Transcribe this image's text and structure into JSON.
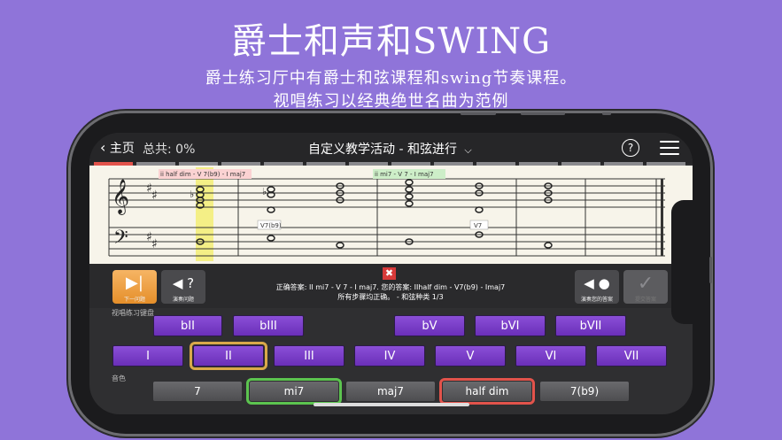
{
  "promo": {
    "headline": "爵士和声和SWING",
    "line1": "爵士练习厅中有爵士和弦课程和swing节奏课程。",
    "line2": "视唱练习以经典绝世名曲为范例"
  },
  "topbar": {
    "back_label": "主页",
    "progress_label": "总共: 0%",
    "title": "自定义教学活动 - 和弦进行",
    "help_icon": "?"
  },
  "staff": {
    "annotation1": "ii half dim - V 7(b9) - I maj7",
    "annotation2": "ii mi7 - V 7 - I maj7",
    "chord_label1": "V7(b9)",
    "chord_label2": "V7"
  },
  "controls": {
    "next_caption": "下一问题",
    "play_question_caption": "演奏问题",
    "play_answer_caption": "演奏您的答案",
    "submit_caption": "提交答案",
    "feedback_line1": "正确答案: II mi7 - V 7 - I maj7. 您的答案: IIhalf dim - V7(b9) - Imaj7",
    "feedback_line2": "所有步骤均正确。 - 和弦种类 1/3",
    "wrong_icon": "✖"
  },
  "keyboard": {
    "section_label": "视唱练习键盘",
    "row1": [
      "bII",
      "bIII",
      "bV",
      "bVI",
      "bVII"
    ],
    "row2": [
      "I",
      "II",
      "III",
      "IV",
      "V",
      "VI",
      "VII"
    ],
    "color_label": "音色",
    "qualities": [
      "7",
      "mi7",
      "maj7",
      "half dim",
      "7(b9)"
    ]
  },
  "colors": {
    "background": "#8f74d9",
    "degree_button": "#7a3fcb",
    "selected_orange": "#d9a94a",
    "correct_green": "#5cc44f",
    "wrong_red": "#e2534b"
  }
}
